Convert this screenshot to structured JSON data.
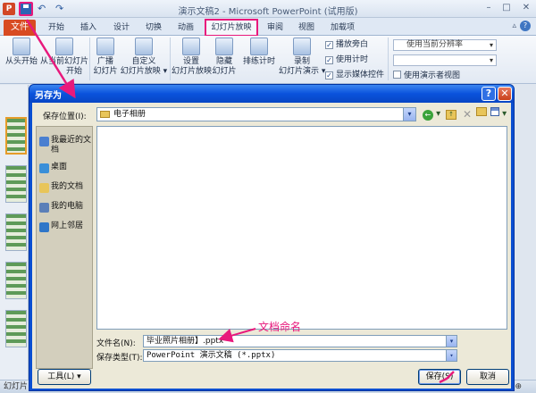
{
  "window": {
    "app_logo": "P",
    "title": "演示文稿2 - Microsoft PowerPoint (试用版)",
    "undo_glyph": "↶",
    "redo_glyph": "↷",
    "minimize": "–",
    "maximize": "□",
    "close": "✕"
  },
  "tabs": {
    "file": "文件",
    "home": "开始",
    "insert": "插入",
    "design": "设计",
    "transitions": "切换",
    "animations": "动画",
    "slideshow": "幻灯片放映",
    "review": "审阅",
    "view": "视图",
    "addins": "加载项",
    "collapse": "▵",
    "help": "?"
  },
  "ribbon": {
    "from_beginning": "从头开始",
    "from_current": "从当前幻灯片",
    "group_start": "开始",
    "broadcast_line1": "广播",
    "broadcast_line2": "幻灯片",
    "custom_line1": "自定义",
    "custom_line2": "幻灯片放映 ▾",
    "setup_line1": "设置",
    "setup_line2": "幻灯片放映",
    "hide_line1": "隐藏",
    "hide_line2": "幻灯片",
    "rehearse": "排练计时",
    "record_line1": "录制",
    "record_line2": "幻灯片演示 ▾",
    "play_narrations": "播放旁白",
    "use_timings": "使用计时",
    "show_media_controls": "显示媒体控件",
    "resolution": "使用当前分辨率",
    "presenter_view": "使用演示者视图"
  },
  "thumbnails": {
    "numbers": [
      "11",
      "12",
      "13",
      "14",
      "15"
    ]
  },
  "statusbar": {
    "left": "幻灯片",
    "zoom": "⊕"
  },
  "dialog": {
    "title": "另存为",
    "help": "?",
    "close": "✕",
    "save_in_label": "保存位置(I):",
    "save_in_value": "电子相册",
    "back_glyph": "←",
    "up_glyph": "↑",
    "delete_glyph": "✕",
    "places": [
      {
        "label": "我最近的文档",
        "color": "#4a7fd0"
      },
      {
        "label": "桌面",
        "color": "#3a8fd8"
      },
      {
        "label": "我的文档",
        "color": "#e8c55a"
      },
      {
        "label": "我的电脑",
        "color": "#5b7fb8"
      },
      {
        "label": "网上邻居",
        "color": "#2f76c8"
      }
    ],
    "filename_label": "文件名(N):",
    "filename_value": "毕业照片相册】.pptx",
    "filetype_label": "保存类型(T):",
    "filetype_value": "PowerPoint 演示文稿 (*.pptx)",
    "tools_button": "工具(L) ▾",
    "save_button": "保存(S)",
    "cancel_button": "取消"
  },
  "annotation": {
    "text": "文档命名",
    "color": "#e8197c"
  }
}
